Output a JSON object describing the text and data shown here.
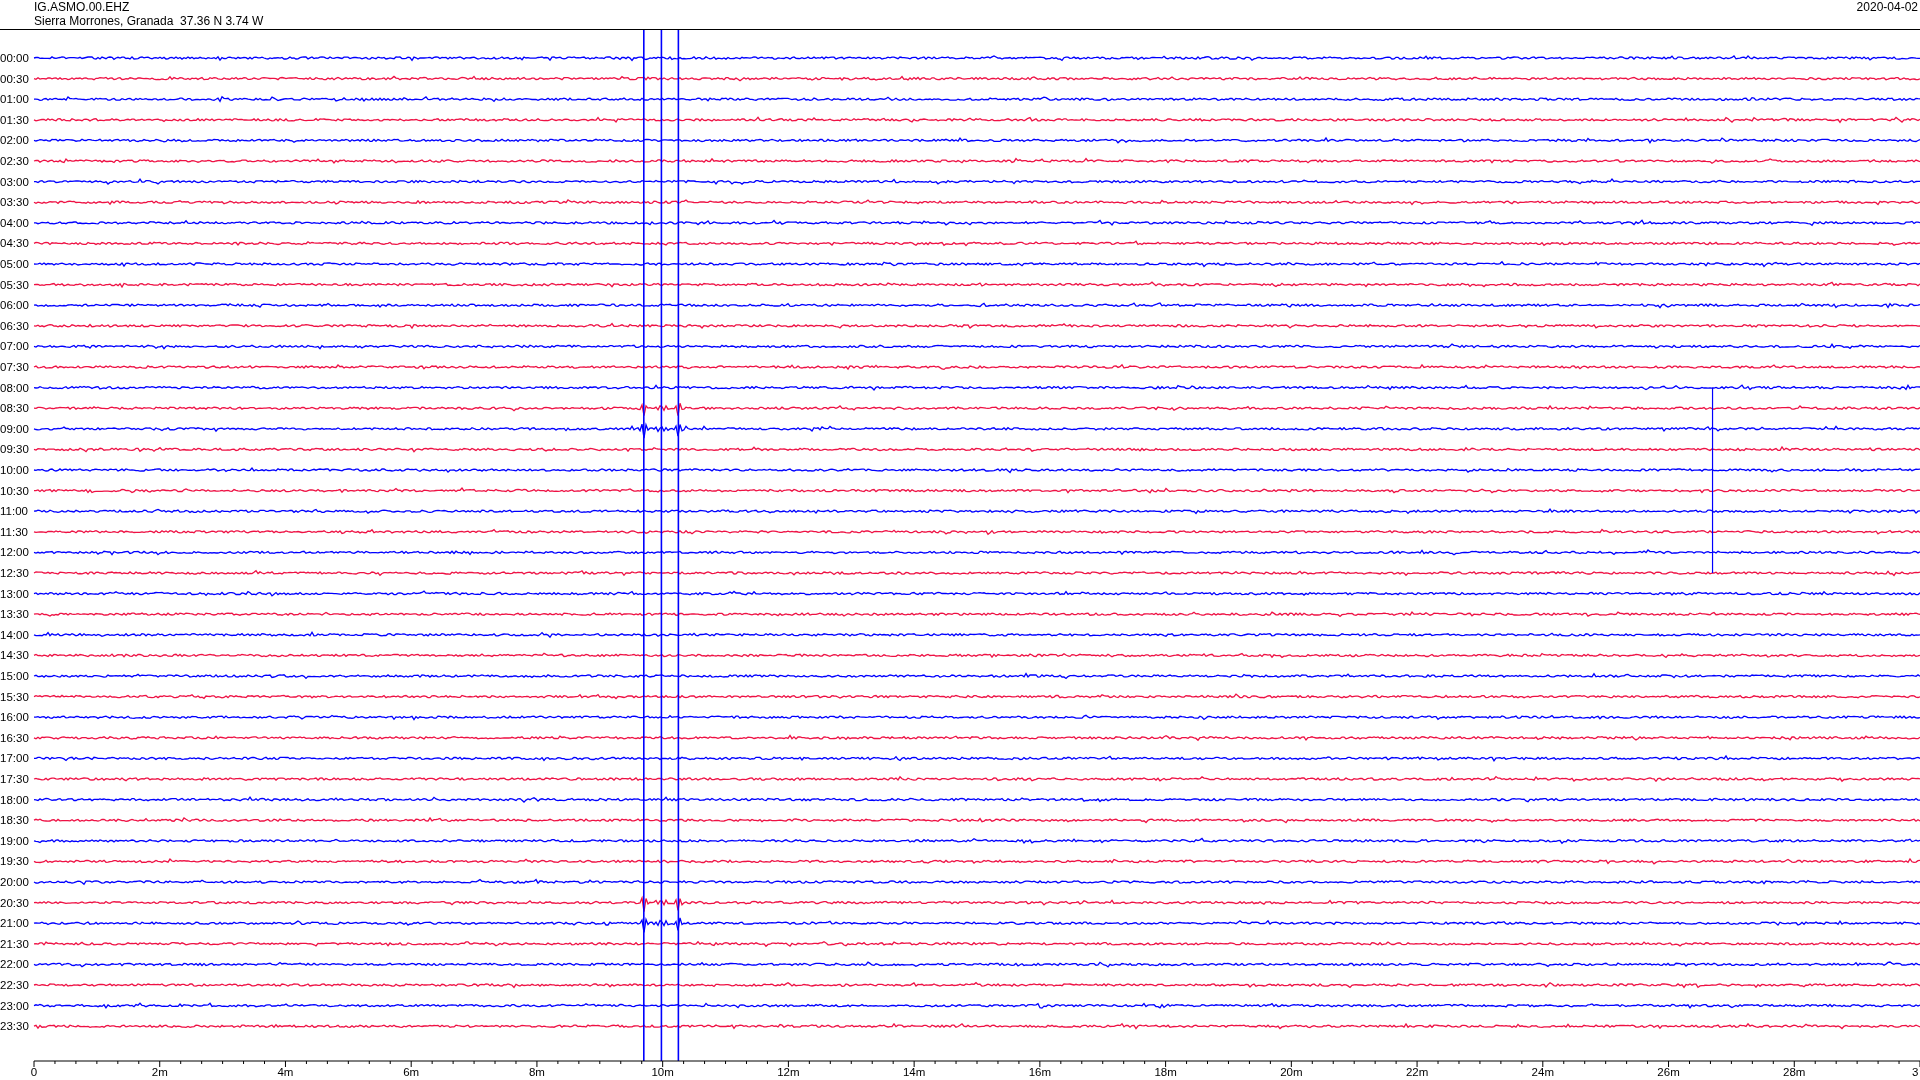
{
  "header": {
    "station": "IG.ASMO.00.EHZ",
    "location": "Sierra Morrones, Granada  37.36 N 3.74 W",
    "date": "2020-04-02"
  },
  "rows": [
    {
      "label": "00:00",
      "color": "#0000ff"
    },
    {
      "label": "00:30",
      "color": "#ee1144"
    },
    {
      "label": "01:00",
      "color": "#0000ff"
    },
    {
      "label": "01:30",
      "color": "#ee1144"
    },
    {
      "label": "02:00",
      "color": "#0000ff"
    },
    {
      "label": "02:30",
      "color": "#ee1144"
    },
    {
      "label": "03:00",
      "color": "#0000ff"
    },
    {
      "label": "03:30",
      "color": "#ee1144"
    },
    {
      "label": "04:00",
      "color": "#0000ff"
    },
    {
      "label": "04:30",
      "color": "#ee1144"
    },
    {
      "label": "05:00",
      "color": "#0000ff"
    },
    {
      "label": "05:30",
      "color": "#ee1144"
    },
    {
      "label": "06:00",
      "color": "#0000ff"
    },
    {
      "label": "06:30",
      "color": "#ee1144"
    },
    {
      "label": "07:00",
      "color": "#0000ff"
    },
    {
      "label": "07:30",
      "color": "#ee1144"
    },
    {
      "label": "08:00",
      "color": "#0000ff"
    },
    {
      "label": "08:30",
      "color": "#ee1144"
    },
    {
      "label": "09:00",
      "color": "#0000ff"
    },
    {
      "label": "09:30",
      "color": "#ee1144"
    },
    {
      "label": "10:00",
      "color": "#0000ff"
    },
    {
      "label": "10:30",
      "color": "#ee1144"
    },
    {
      "label": "11:00",
      "color": "#0000ff"
    },
    {
      "label": "11:30",
      "color": "#ee1144"
    },
    {
      "label": "12:00",
      "color": "#0000ff"
    },
    {
      "label": "12:30",
      "color": "#ee1144"
    },
    {
      "label": "13:00",
      "color": "#0000ff"
    },
    {
      "label": "13:30",
      "color": "#ee1144"
    },
    {
      "label": "14:00",
      "color": "#0000ff"
    },
    {
      "label": "14:30",
      "color": "#ee1144"
    },
    {
      "label": "15:00",
      "color": "#0000ff"
    },
    {
      "label": "15:30",
      "color": "#ee1144"
    },
    {
      "label": "16:00",
      "color": "#0000ff"
    },
    {
      "label": "16:30",
      "color": "#ee1144"
    },
    {
      "label": "17:00",
      "color": "#0000ff"
    },
    {
      "label": "17:30",
      "color": "#ee1144"
    },
    {
      "label": "18:00",
      "color": "#0000ff"
    },
    {
      "label": "18:30",
      "color": "#ee1144"
    },
    {
      "label": "19:00",
      "color": "#0000ff"
    },
    {
      "label": "19:30",
      "color": "#ee1144"
    },
    {
      "label": "20:00",
      "color": "#0000ff"
    },
    {
      "label": "20:30",
      "color": "#ee1144"
    },
    {
      "label": "21:00",
      "color": "#0000ff"
    },
    {
      "label": "21:30",
      "color": "#ee1144"
    },
    {
      "label": "22:00",
      "color": "#0000ff"
    },
    {
      "label": "22:30",
      "color": "#ee1144"
    },
    {
      "label": "23:00",
      "color": "#0000ff"
    },
    {
      "label": "23:30",
      "color": "#ee1144"
    }
  ],
  "x_axis": {
    "ticks": [
      {
        "label": "0"
      },
      {
        "label": "2m"
      },
      {
        "label": "4m"
      },
      {
        "label": "6m"
      },
      {
        "label": "8m"
      },
      {
        "label": "10m"
      },
      {
        "label": "12m"
      },
      {
        "label": "14m"
      },
      {
        "label": "16m"
      },
      {
        "label": "18m"
      },
      {
        "label": "20m"
      },
      {
        "label": "22m"
      },
      {
        "label": "24m"
      },
      {
        "label": "26m"
      },
      {
        "label": "28m"
      },
      {
        "label": "3"
      }
    ]
  }
}
